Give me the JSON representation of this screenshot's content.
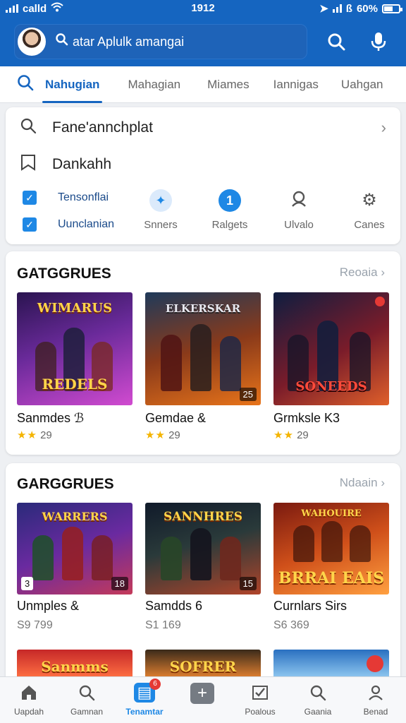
{
  "status": {
    "carrier": "calld",
    "time": "1912",
    "battery": "60%",
    "icons": [
      "signal-icon",
      "wifi-icon",
      "location-icon",
      "bluetooth-icon",
      "battery-icon"
    ]
  },
  "header": {
    "search_text": "atar Aplulk amangai",
    "icons": [
      "avatar",
      "search-icon",
      "mic-icon"
    ]
  },
  "tabs": [
    {
      "label": "Nahugian",
      "active": true
    },
    {
      "label": "Mahagian"
    },
    {
      "label": "Miames"
    },
    {
      "label": "Iannigas"
    },
    {
      "label": "Uahgan"
    }
  ],
  "quick": {
    "row1": "Fane'annchplat",
    "row2": "Dankahh",
    "check1": "Tensonflai",
    "check2": "Uunclanian",
    "actions": [
      {
        "label": "Snners",
        "icon": "compass-icon"
      },
      {
        "label": "Ralgets",
        "icon": "badge-icon"
      },
      {
        "label": "Ulvalo",
        "icon": "user-icon"
      },
      {
        "label": "Canes",
        "icon": "gear-icon"
      }
    ]
  },
  "section1": {
    "title": "GATGGRUES",
    "link": "Reoaia",
    "tiles": [
      {
        "name": "Sanmdes ℬ",
        "art_title": "WIMARUS",
        "art_sub": "REDELS",
        "rating": "29",
        "stars": "★★"
      },
      {
        "name": "Gemdae &",
        "art_title": "ELKERSKAR",
        "art_badge": "25",
        "rating": "29",
        "stars": "★★"
      },
      {
        "name": "Grmksle K3",
        "art_sub": "SONEEDS",
        "rating": "29",
        "stars": "★★"
      }
    ]
  },
  "section2": {
    "title": "GARGGRUES",
    "link": "Ndaain",
    "tiles": [
      {
        "name": "Unmples &",
        "art_title": "WARRERS",
        "art_lbadge": "3",
        "art_badge": "18",
        "price": "S9 799"
      },
      {
        "name": "Samdds 6",
        "art_title": "SANNHRES",
        "art_badge": "15",
        "price": "S1 169"
      },
      {
        "name": "Curnlars Sirs",
        "art_title": "WAHOUIRE",
        "art_sub": "BRRAI EAIS",
        "price": "S6 369"
      }
    ],
    "peek": [
      "Sanmms",
      "SOFRER",
      ""
    ]
  },
  "bottom_nav": [
    {
      "label": "Uapdah",
      "icon": "home-icon"
    },
    {
      "label": "Gamnan",
      "icon": "search-icon"
    },
    {
      "label": "Tenamtar",
      "icon": "store-icon",
      "active": true,
      "badge": "6"
    },
    {
      "label": "",
      "icon": "plus-icon"
    },
    {
      "label": "Poalous",
      "icon": "checklist-icon"
    },
    {
      "label": "Gaania",
      "icon": "search-icon"
    },
    {
      "label": "Benad",
      "icon": "profile-icon"
    }
  ],
  "colors": {
    "primary": "#1565c0",
    "accent": "#1e88e5",
    "badge": "#e53935",
    "star": "#f4b400"
  }
}
